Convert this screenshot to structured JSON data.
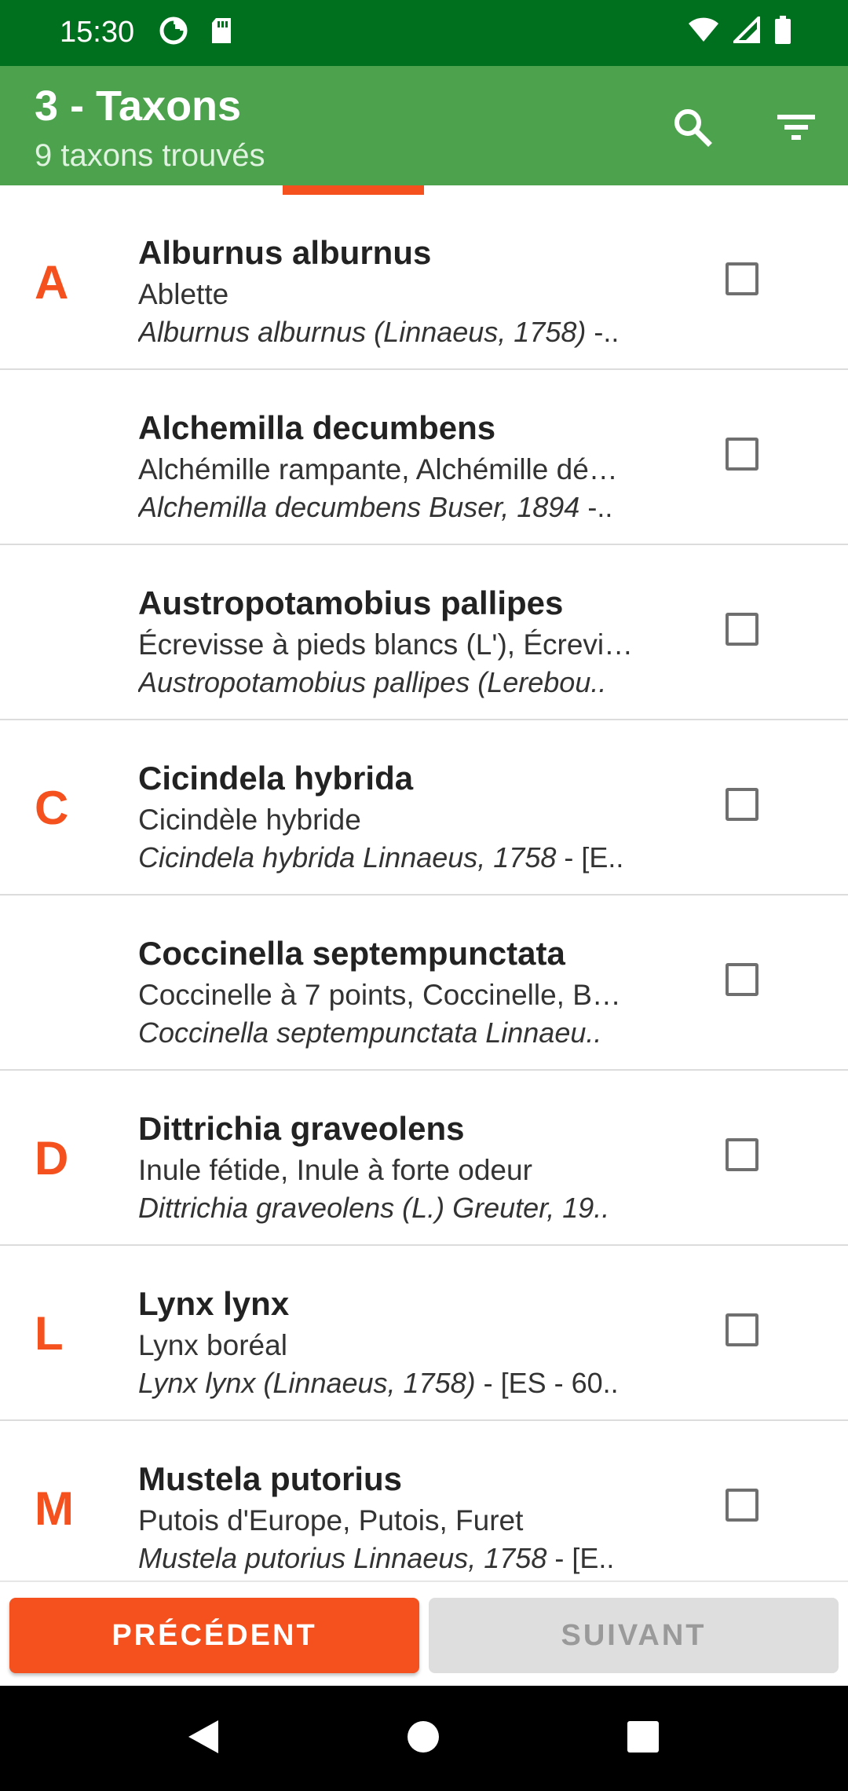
{
  "status_bar": {
    "time": "15:30",
    "left_icons": [
      "data-saver-icon",
      "sd-card-icon"
    ],
    "right_icons": [
      "wifi-icon",
      "signal-icon",
      "battery-icon"
    ]
  },
  "app_bar": {
    "title": "3 - Taxons",
    "subtitle": "9 taxons trouvés",
    "icons": [
      "search-icon",
      "filter-icon"
    ]
  },
  "colors": {
    "status_bar": "#00701f",
    "app_bar": "#4da34d",
    "accent": "#f4511e",
    "disabled_button": "#dedede"
  },
  "taxa": [
    {
      "letter": "A",
      "title": "Alburnus alburnus",
      "common": "Ablette",
      "sci_italic": "Alburnus alburnus (Linnaeus, 1758)",
      "sci_rest": " -..",
      "checked": false
    },
    {
      "letter": "",
      "title": "Alchemilla decumbens",
      "common": "Alchémille rampante, Alchémille dé…",
      "sci_italic": "Alchemilla decumbens Buser, 1894",
      "sci_rest": " -..",
      "checked": false
    },
    {
      "letter": "",
      "title": "Austropotamobius pallipes",
      "common": "Écrevisse à pieds blancs (L'), Écrevi…",
      "sci_italic": "Austropotamobius pallipes (Lerebou..",
      "sci_rest": "",
      "checked": false
    },
    {
      "letter": "C",
      "title": "Cicindela hybrida",
      "common": "Cicindèle hybride",
      "sci_italic": "Cicindela hybrida Linnaeus, 1758",
      "sci_rest": " - [E..",
      "checked": false
    },
    {
      "letter": "",
      "title": "Coccinella septempunctata",
      "common": "Coccinelle à 7 points, Coccinelle, B…",
      "sci_italic": "Coccinella septempunctata Linnaeu..",
      "sci_rest": "",
      "checked": false
    },
    {
      "letter": "D",
      "title": "Dittrichia graveolens",
      "common": "Inule fétide, Inule à forte odeur",
      "sci_italic": "Dittrichia graveolens (L.) Greuter, 19..",
      "sci_rest": "",
      "checked": false
    },
    {
      "letter": "L",
      "title": "Lynx lynx",
      "common": "Lynx boréal",
      "sci_italic": "Lynx lynx (Linnaeus, 1758)",
      "sci_rest": " - [ES - 60..",
      "checked": false
    },
    {
      "letter": "M",
      "title": "Mustela putorius",
      "common": "Putois d'Europe, Putois, Furet",
      "sci_italic": "Mustela putorius Linnaeus, 1758",
      "sci_rest": " - [E..",
      "checked": false
    }
  ],
  "footer": {
    "prev_label": "PRÉCÉDENT",
    "next_label": "SUIVANT"
  },
  "nav_bar": {
    "icons": [
      "back-icon",
      "home-icon",
      "recents-icon"
    ]
  }
}
